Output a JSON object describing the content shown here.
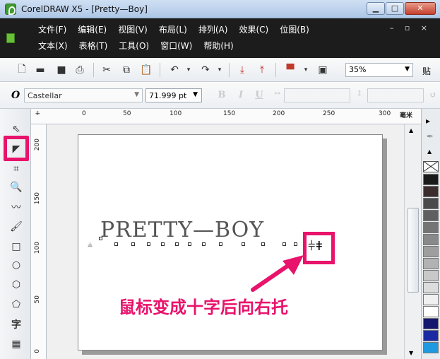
{
  "window": {
    "title": "CorelDRAW X5 - [Pretty—Boy]"
  },
  "menu": {
    "row1": [
      "文件(F)",
      "编辑(E)",
      "视图(V)",
      "布局(L)",
      "排列(A)",
      "效果(C)",
      "位图(B)"
    ],
    "row2": [
      "文本(X)",
      "表格(T)",
      "工具(O)",
      "窗口(W)",
      "帮助(H)"
    ]
  },
  "toolbar": {
    "zoom": "35%",
    "paste_label": "贴"
  },
  "property_bar": {
    "font_name": "Castellar",
    "font_size": "71.999 pt",
    "font_icon": "O"
  },
  "ruler": {
    "top_labels": [
      "0",
      "50",
      "100",
      "150",
      "200",
      "250",
      "300"
    ],
    "unit": "毫米",
    "left_labels": [
      "200",
      "150",
      "100",
      "50",
      "0"
    ]
  },
  "canvas": {
    "art_text": "PRETTY—BOY",
    "annotation": "鼠标变成十字后向右托",
    "highlight_color": "#e8136b"
  },
  "toolbox": {
    "icons": [
      "pick-tool-icon",
      "shape-tool-icon",
      "crop-tool-icon",
      "zoom-tool-icon",
      "freehand-tool-icon",
      "smart-fill-icon",
      "rectangle-tool-icon",
      "ellipse-tool-icon",
      "polygon-tool-icon",
      "basic-shapes-icon",
      "text-tool-icon",
      "table-tool-icon"
    ],
    "text_tool_label": "字"
  },
  "palette": {
    "colors": [
      "#1a1a1a",
      "#3b2d2d",
      "#4a4a4a",
      "#5f5f5f",
      "#747474",
      "#898989",
      "#9e9e9e",
      "#b2b2b2",
      "#c8c8c8",
      "#dcdcdc",
      "#f0f0f0",
      "#ffffff",
      "#15176e",
      "#1b2aa3",
      "#1f9ae0"
    ]
  }
}
